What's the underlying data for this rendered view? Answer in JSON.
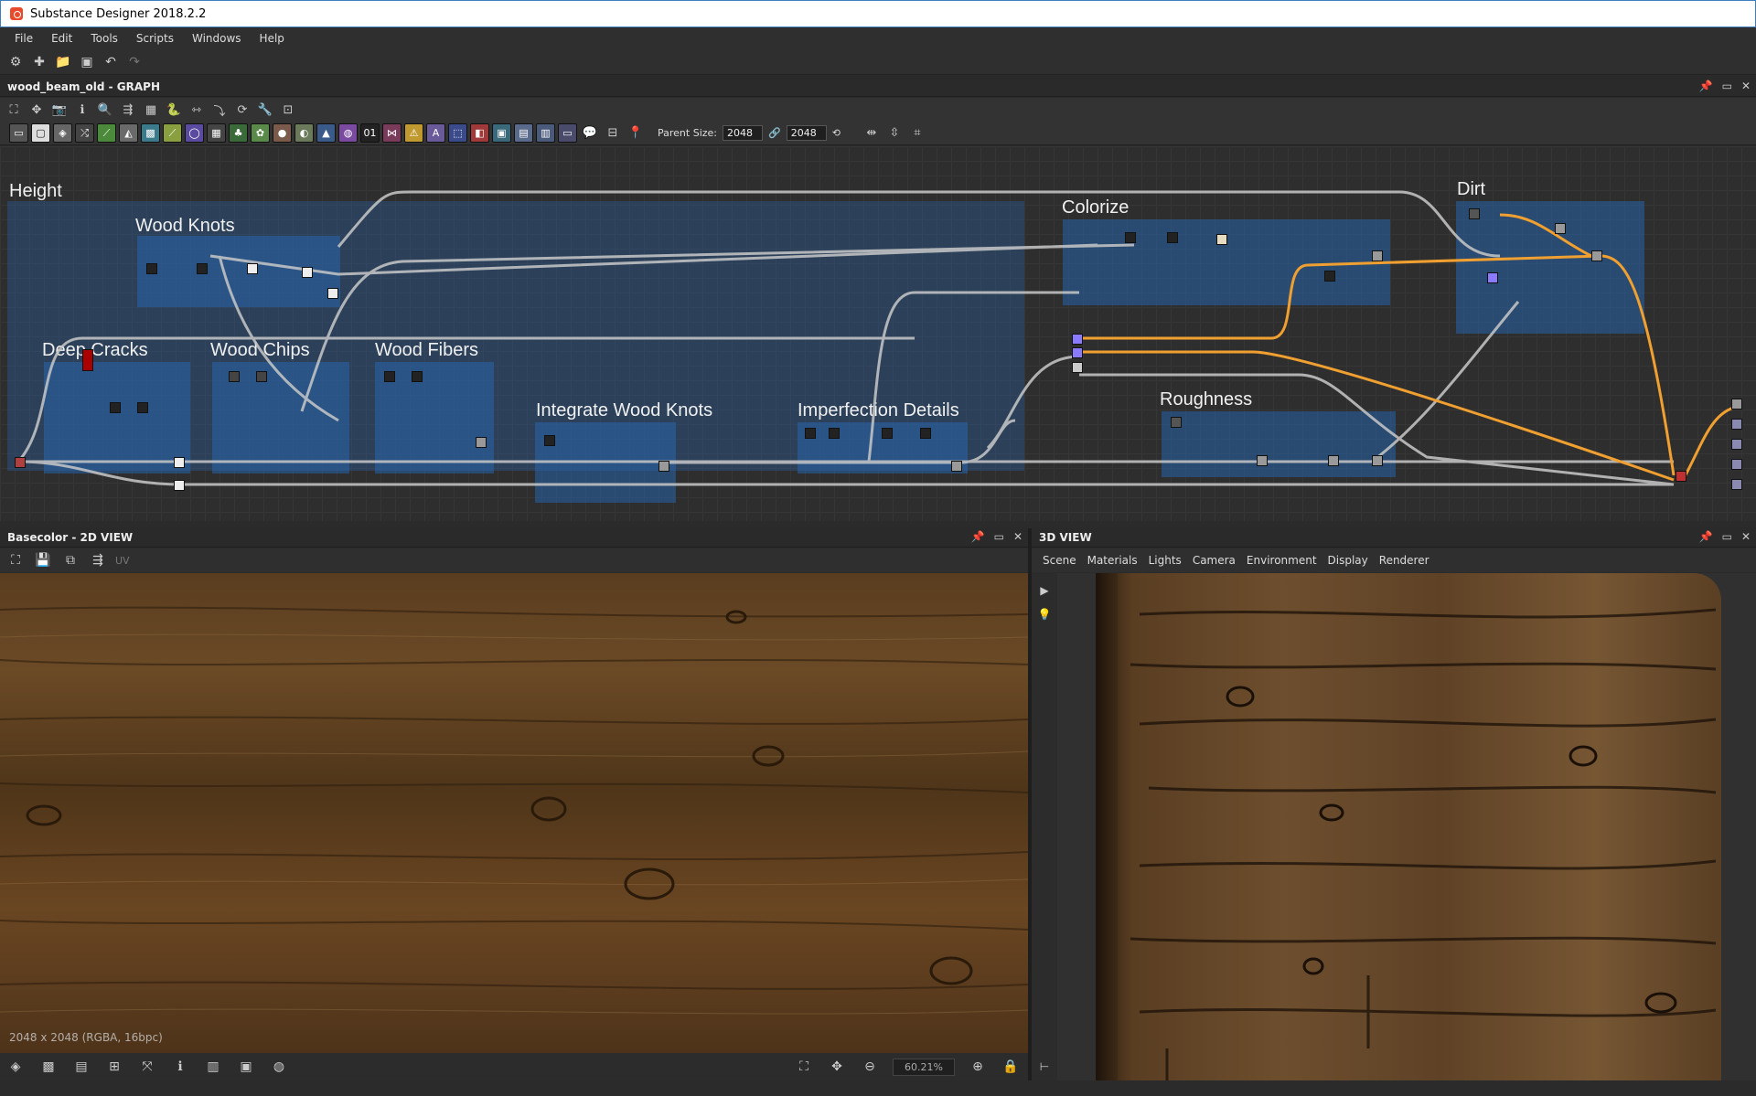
{
  "window": {
    "title": "Substance Designer 2018.2.2"
  },
  "menu": [
    "File",
    "Edit",
    "Tools",
    "Scripts",
    "Windows",
    "Help"
  ],
  "graph_panel": {
    "title": "wood_beam_old - GRAPH",
    "parent_size_label": "Parent Size:",
    "parent_size_w": "2048",
    "parent_size_h": "2048"
  },
  "frames": {
    "height": "Height",
    "wood_knots": "Wood Knots",
    "deep_cracks": "Deep Cracks",
    "wood_chips": "Wood Chips",
    "wood_fibers": "Wood Fibers",
    "integrate_wood_knots": "Integrate Wood Knots",
    "imperfection_details": "Imperfection Details",
    "colorize": "Colorize",
    "dirt": "Dirt",
    "roughness": "Roughness"
  },
  "view2d": {
    "title": "Basecolor - 2D VIEW",
    "uv_label": "UV",
    "resolution": "2048 x 2048 (RGBA, 16bpc)",
    "zoom": "60.21%"
  },
  "view3d": {
    "title": "3D VIEW",
    "tabs": [
      "Scene",
      "Materials",
      "Lights",
      "Camera",
      "Environment",
      "Display",
      "Renderer"
    ]
  },
  "colors": {
    "accent": "#3c7fbf",
    "frame_blue": "#2864aa",
    "wire_orange": "#f0a030",
    "wire_gray": "#c8c8c8"
  }
}
